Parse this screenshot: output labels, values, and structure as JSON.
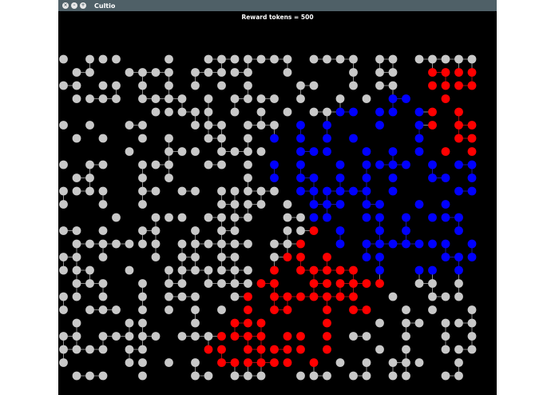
{
  "window": {
    "title": "Cultio",
    "controls": [
      "close",
      "minimize",
      "maximize"
    ]
  },
  "status": {
    "reward_text": "Reward tokens = 500"
  },
  "colors": {
    "titlebar": "#4f6067",
    "canvas": "#000000",
    "neutral": "#c8c8c8",
    "player_red": "#ff0000",
    "player_blue": "#0000ff",
    "edge": "#8a8a8a"
  }
}
